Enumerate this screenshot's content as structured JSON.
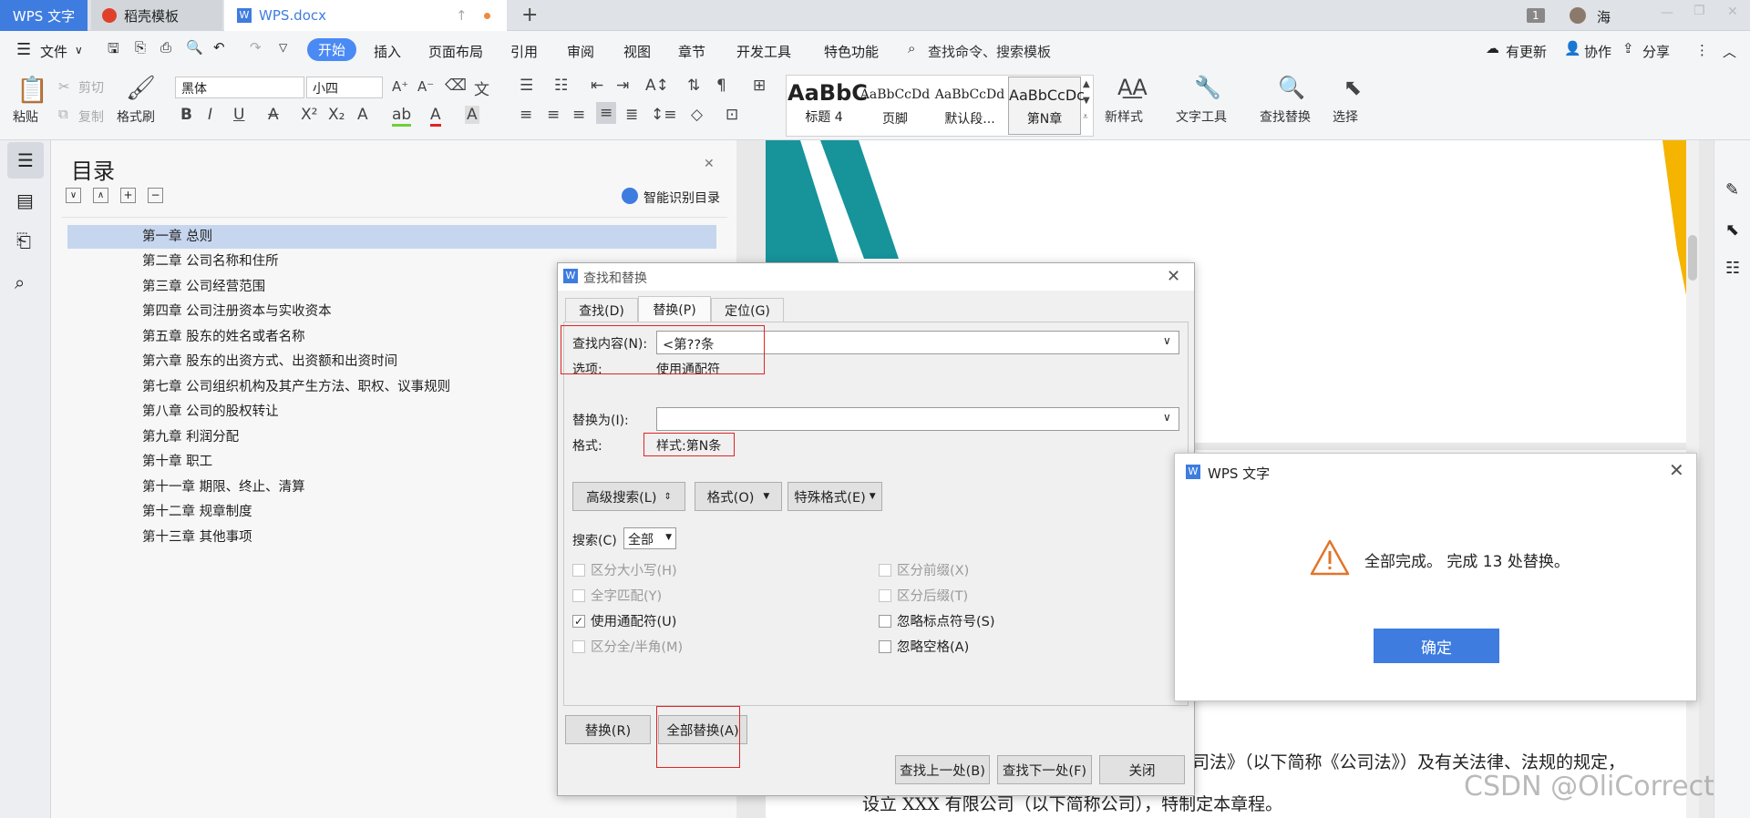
{
  "titlebar": {
    "app_tab": "WPS 文字",
    "tab2": "稻壳模板",
    "tab3": "WPS.docx",
    "window_count": "1",
    "user": "海"
  },
  "menubar": {
    "file": "文件",
    "tabs": [
      "开始",
      "插入",
      "页面布局",
      "引用",
      "审阅",
      "视图",
      "章节",
      "开发工具",
      "特色功能"
    ],
    "search_placeholder": "查找命令、搜索模板",
    "update": "有更新",
    "collab": "协作",
    "share": "分享"
  },
  "ribbon": {
    "paste": "粘贴",
    "cut": "剪切",
    "copy": "复制",
    "format_painter": "格式刷",
    "font_name": "黑体",
    "font_size": "小四",
    "styles": [
      {
        "preview": "AaBbC",
        "name": "标题 4"
      },
      {
        "preview": "AaBbCcDd",
        "name": "页脚"
      },
      {
        "preview": "AaBbCcDd",
        "name": "默认段..."
      },
      {
        "preview": "AaBbCcDc",
        "name": "第N章"
      }
    ],
    "new_style": "新样式",
    "text_tools": "文字工具",
    "find_replace": "查找替换",
    "select": "选择"
  },
  "toc": {
    "title": "目录",
    "smart": "智能识别目录",
    "items": [
      "第一章  总则",
      "第二章  公司名称和住所",
      "第三章  公司经营范围",
      "第四章  公司注册资本与实收资本",
      "第五章  股东的姓名或者名称",
      "第六章  股东的出资方式、出资额和出资时间",
      "第七章  公司组织机构及其产生方法、职权、议事规则",
      "第八章  公司的股权转让",
      "第九章  利润分配",
      "第十章  职工",
      "第十一章  期限、终止、清算",
      "第十二章  规章制度",
      "第十三章  其他事项"
    ]
  },
  "document": {
    "line1": "司法》（以下简称《公司法》）及有关法律、法规的规定，",
    "line2": "设立 XXX 有限公司（以下简称公司），特制定本章程。",
    "watermark": "CSDN @OliCorrect"
  },
  "find_dialog": {
    "title": "查找和替换",
    "tabs": [
      "查找(D)",
      "替换(P)",
      "定位(G)"
    ],
    "find_label": "查找内容(N):",
    "find_value": "<第??条",
    "options_label": "选项:",
    "options_value": "使用通配符",
    "replace_label": "替换为(I):",
    "replace_value": "",
    "format_label": "格式:",
    "format_value": "样式:第N条",
    "advanced": "高级搜索(L)",
    "format_btn": "格式(O)",
    "special_btn": "特殊格式(E)",
    "search_label": "搜索(C)",
    "search_value": "全部",
    "options_left": [
      {
        "label": "区分大小写(H)",
        "checked": false,
        "disabled": true
      },
      {
        "label": "全字匹配(Y)",
        "checked": false,
        "disabled": true
      },
      {
        "label": "使用通配符(U)",
        "checked": true,
        "disabled": false
      },
      {
        "label": "区分全/半角(M)",
        "checked": false,
        "disabled": true
      }
    ],
    "options_right": [
      {
        "label": "区分前缀(X)",
        "checked": false,
        "disabled": true
      },
      {
        "label": "区分后缀(T)",
        "checked": false,
        "disabled": true
      },
      {
        "label": "忽略标点符号(S)",
        "checked": false,
        "disabled": false
      },
      {
        "label": "忽略空格(A)",
        "checked": false,
        "disabled": false
      }
    ],
    "replace_btn": "替换(R)",
    "replace_all_btn": "全部替换(A)",
    "find_prev": "查找上一处(B)",
    "find_next": "查找下一处(F)",
    "close": "关闭"
  },
  "alert": {
    "title": "WPS 文字",
    "message": "全部完成。 完成 13 处替换。",
    "ok": "确定"
  }
}
